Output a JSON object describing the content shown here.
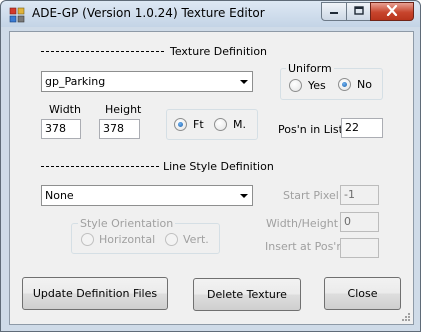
{
  "window": {
    "title": "ADE-GP (Version 1.0.24) Texture Editor"
  },
  "texture_definition": {
    "section_label": "Texture Definition",
    "texture_combo_value": "gp_Parking",
    "uniform": {
      "title": "Uniform",
      "yes_label": "Yes",
      "no_label": "No",
      "selected": "No"
    },
    "width_label": "Width",
    "width_value": "378",
    "height_label": "Height",
    "height_value": "378",
    "units": {
      "ft_label": "Ft",
      "m_label": "M.",
      "selected": "Ft"
    },
    "pos_in_list_label": "Pos'n in List",
    "pos_in_list_value": "22"
  },
  "line_style_definition": {
    "section_label": "Line Style Definition",
    "line_style_combo_value": "None",
    "style_orientation": {
      "title": "Style Orientation",
      "horizontal_label": "Horizontal",
      "vertical_label": "Vert."
    },
    "start_pixel_label": "Start Pixel",
    "start_pixel_value": "-1",
    "width_height_label": "Width/Height",
    "width_height_value": "0",
    "insert_at_pos_label": "Insert at Pos'n",
    "insert_at_pos_value": ""
  },
  "buttons": {
    "update_label": "Update Definition Files",
    "delete_label": "Delete Texture",
    "close_label": "Close"
  },
  "colors": {
    "title_bar": "#cfdbe8",
    "client_bg": "#f0f0f0",
    "close_button": "#c7452d",
    "radio_dot": "#1d5fa8"
  },
  "icons": {
    "app": "app-icon",
    "minimize": "minimize-icon",
    "maximize": "maximize-icon",
    "close": "close-icon"
  }
}
